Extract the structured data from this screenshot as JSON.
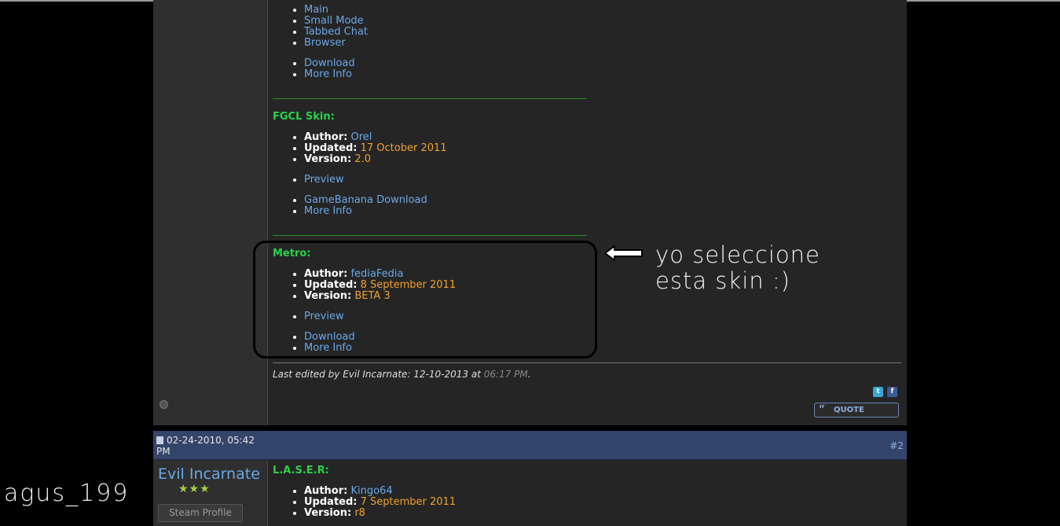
{
  "post1": {
    "top_links": [
      "Main",
      "Small Mode",
      "Tabbed Chat",
      "Browser"
    ],
    "top_links2": [
      "Download",
      "More Info"
    ],
    "fgcl": {
      "title": "FGCL Skin:",
      "author_label": "Author:",
      "author": "Orel",
      "updated_label": "Updated:",
      "updated": "17 October 2011",
      "version_label": "Version:",
      "version": "2.0",
      "preview": "Preview",
      "download": "GameBanana Download",
      "more_info": "More Info"
    },
    "metro": {
      "title": "Metro:",
      "author_label": "Author:",
      "author": "fediaFedia",
      "updated_label": "Updated:",
      "updated": "8 September 2011",
      "version_label": "Version:",
      "version": "BETA 3",
      "preview": "Preview",
      "download": "Download",
      "more_info": "More Info"
    },
    "edited_prefix": "Last edited by Evil Incarnate: 12-10-2013 at",
    "edited_time": "06:17 PM",
    "edited_suffix": ".",
    "quote_label": "QUOTE",
    "twitter_icon_text": "t",
    "facebook_icon_text": "f"
  },
  "annotation": {
    "line1": "yo seleccione",
    "line2": "esta skin :)"
  },
  "signature": "agus_199",
  "post2": {
    "date": "02-24-2010, 05:42 PM",
    "number": "#2",
    "username": "Evil Incarnate",
    "stars": "★★★",
    "steam_profile": "Steam Profile",
    "laser": {
      "title": "L.A.S.E.R:",
      "author_label": "Author:",
      "author": "Kingo64",
      "updated_label": "Updated:",
      "updated": "7 September 2011",
      "version_label": "Version:",
      "version": "r8"
    }
  },
  "colors": {
    "link": "#6aa8e8",
    "date_orange": "#f0a030",
    "section_green": "#2ad14a",
    "header_blue": "#33456b"
  }
}
